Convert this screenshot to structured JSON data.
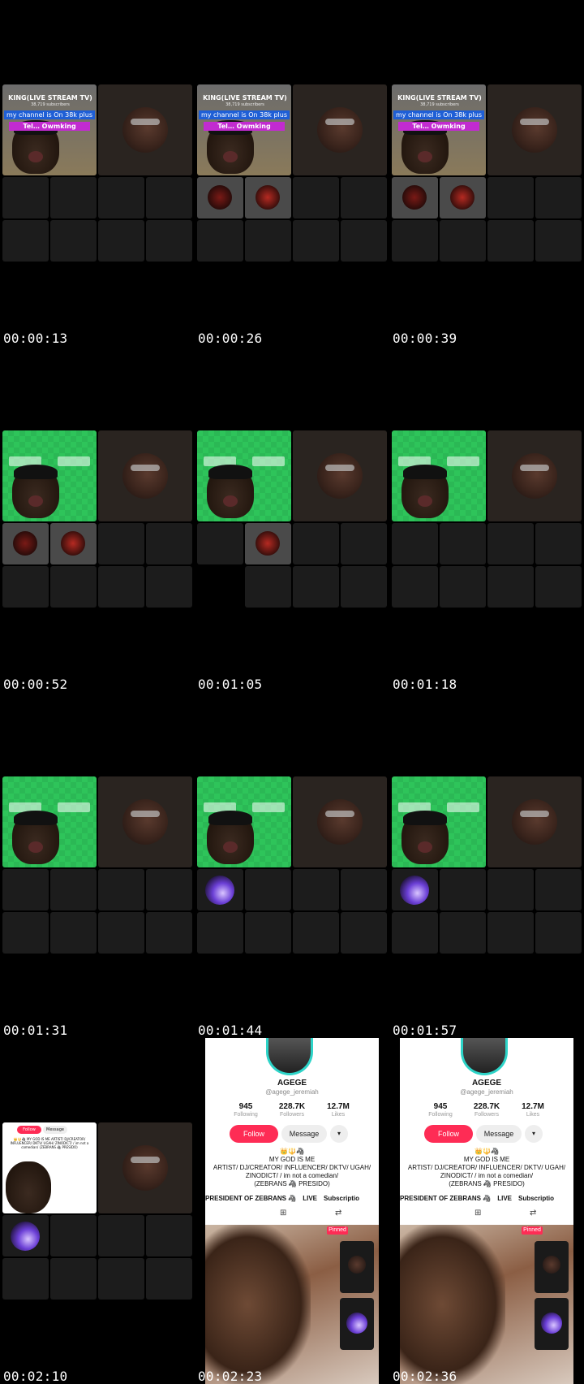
{
  "timestamps": [
    "00:00:13",
    "00:00:26",
    "00:00:39",
    "00:00:52",
    "00:01:05",
    "00:01:18",
    "00:01:31",
    "00:01:44",
    "00:01:57",
    "00:02:10",
    "00:02:23",
    "00:02:36"
  ],
  "youtube_overlay": {
    "title": "KING(LIVE STREAM TV)",
    "subscribers": "38,719 subscribers",
    "banner": "my channel is On 38k plus",
    "tag": "Tel… Owmking"
  },
  "tiktok": {
    "name": "AGEGE",
    "handle": "@agege_jeremiah",
    "stats": [
      {
        "value": "945",
        "label": "Following"
      },
      {
        "value": "228.7K",
        "label": "Followers"
      },
      {
        "value": "12.7M",
        "label": "Likes"
      }
    ],
    "follow_label": "Follow",
    "message_label": "Message",
    "more_label": "▾",
    "bio": "👑🔱🦓\nMY GOD IS ME\nARTIST/ DJ/CREATOR/ INFLUENCER/ DKTV/ UGAH/\nZINODICT/ / im not a comedian/\n(ZEBRANS 🦓 PRESIDO)",
    "links": [
      "PRESIDENT OF ZEBRANS 🦓",
      "LIVE",
      "Subscriptio"
    ],
    "pinned_label": "Pinned"
  },
  "colors": {
    "tiktok_red": "#fe2c55",
    "green_screen": "#2ec45a",
    "teal_ring": "#2dd4c8"
  }
}
